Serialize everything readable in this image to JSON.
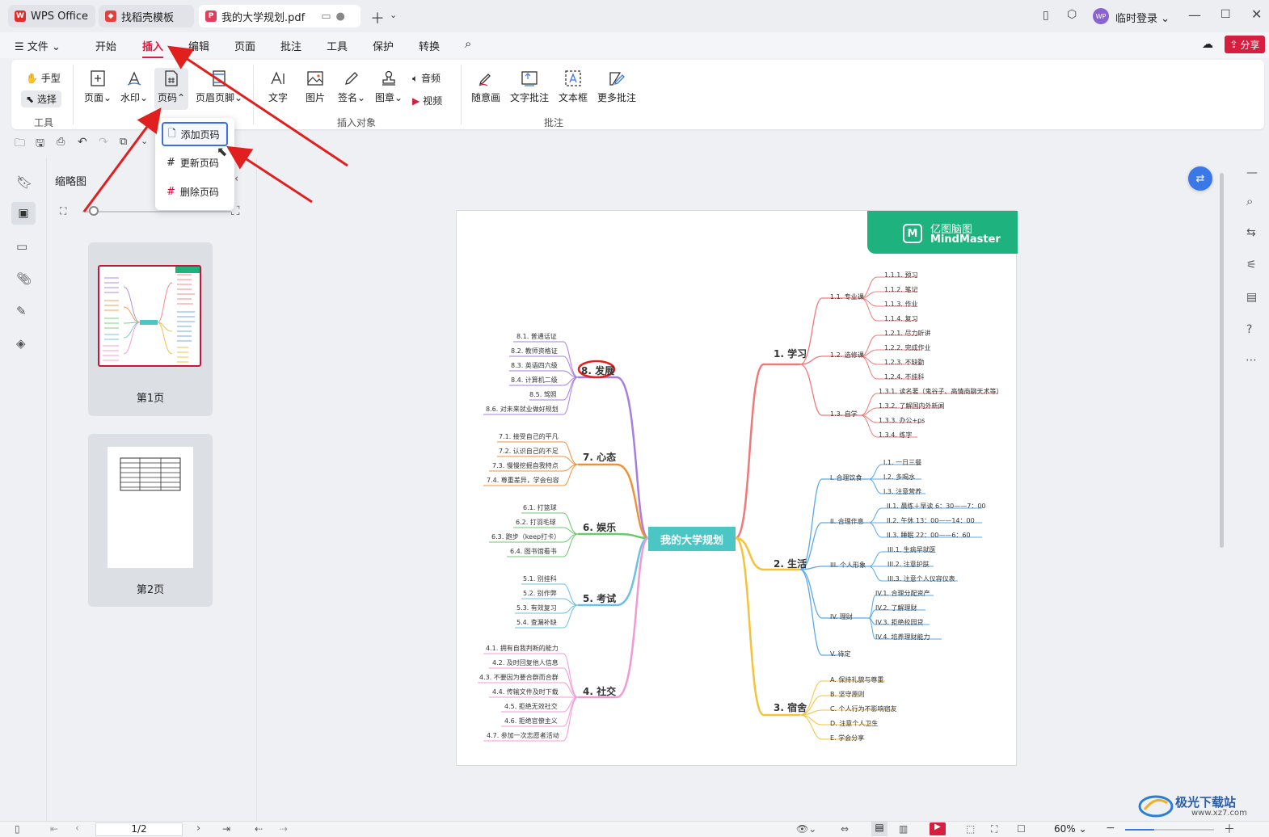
{
  "tabs": [
    {
      "label": "WPS Office"
    },
    {
      "label": "找稻壳模板"
    },
    {
      "label": "我的大学规划.pdf"
    }
  ],
  "account": {
    "label": "临时登录",
    "avatar": "WP"
  },
  "menu": {
    "file": "文件",
    "items": [
      "开始",
      "插入",
      "编辑",
      "页面",
      "批注",
      "工具",
      "保护",
      "转换"
    ],
    "share": "分享"
  },
  "ribbon": {
    "hand": "手型",
    "select": "选择",
    "group_tools": "工具",
    "page": "页面",
    "watermark": "水印",
    "pagenum": "页码",
    "headerfooter": "页眉页脚",
    "text": "文字",
    "image": "图片",
    "sign": "签名",
    "stamp": "图章",
    "audio": "音频",
    "video": "视频",
    "group_insert": "插入对象",
    "freehand": "随意画",
    "textnote": "文字批注",
    "textbox": "文本框",
    "morenote": "更多批注",
    "group_annot": "批注"
  },
  "dropdown": {
    "add": "添加页码",
    "update": "更新页码",
    "delete": "删除页码"
  },
  "thumbs": {
    "title": "缩略图",
    "page1": "第1页",
    "page2": "第2页"
  },
  "status": {
    "page": "1/2",
    "zoom": "60%"
  },
  "mindmap": {
    "brand_cn": "亿图脑图",
    "brand_en": "MindMaster",
    "center": "我的大学规划",
    "r1": "1. 学习",
    "r2": "2. 生活",
    "r3": "3. 宿舍",
    "l8": "8. 发展",
    "l7": "7. 心态",
    "l6": "6. 娱乐",
    "l5": "5. 考试",
    "l4": "4. 社交",
    "r1_sub": [
      "1.1. 专业课",
      "1.2. 选修课",
      "1.3. 自学"
    ],
    "r1_leaf": [
      "1.1.1. 预习",
      "1.1.2. 笔记",
      "1.1.3. 作业",
      "1.1.4. 复习",
      "1.2.1. 尽力听讲",
      "1.2.2. 完成作业",
      "1.2.3. 不缺勤",
      "1.2.4. 不挂科",
      "1.3.1. 读名著（鬼谷子、高情商聊天术等）",
      "1.3.2. 了解国内外新闻",
      "1.3.3. 办公+ps",
      "1.3.4. 练字"
    ],
    "r2_sub": [
      "I. 合理饮食",
      "II. 合理作息",
      "III. 个人形象",
      "IV. 理财",
      "V. 待定"
    ],
    "r2_leaf": [
      "I.1. 一日三餐",
      "I.2. 多喝水",
      "I.3. 注意营养",
      "II.1. 晨练＋早读 6：30——7：00",
      "II.2. 午休 13：00——14：00",
      "II.3. 睡眠 22：00——6：60",
      "III.1. 生病早就医",
      "III.2. 注意护肤",
      "III.3. 注意个人仪容仪表",
      "IV.1. 合理分配资产",
      "IV.2. 了解理财",
      "IV.3. 拒绝校园贷",
      "IV.4. 培养理财能力"
    ],
    "r3_leaf": [
      "A. 保持礼貌与尊重",
      "B. 坚守原则",
      "C. 个人行为不影响宿友",
      "D. 注意个人卫生",
      "E. 学会分享"
    ],
    "l8_leaf": [
      "8.1. 普通话证",
      "8.2. 教师资格证",
      "8.3. 英语四六级",
      "8.4. 计算机二级",
      "8.5. 驾照",
      "8.6. 对未来就业做好规划"
    ],
    "l7_leaf": [
      "7.1. 接受自己的平凡",
      "7.2. 认识自己的不足",
      "7.3. 慢慢挖掘自我特点",
      "7.4. 尊重差异，学会包容"
    ],
    "l6_leaf": [
      "6.1. 打篮球",
      "6.2. 打羽毛球",
      "6.3. 跑步（keep打卡）",
      "6.4. 图书馆看书"
    ],
    "l5_leaf": [
      "5.1. 别挂科",
      "5.2. 别作弊",
      "5.3. 有效复习",
      "5.4. 查漏补缺"
    ],
    "l4_leaf": [
      "4.1. 拥有自我判断的能力",
      "4.2. 及时回复他人信息",
      "4.3. 不要因为要合群而合群",
      "4.4. 传输文件及时下载",
      "4.5. 拒绝无效社交",
      "4.6. 拒绝官僚主义",
      "4.7. 参加一次志愿者活动"
    ]
  },
  "watermark": "极光下载站",
  "watermark_url": "www.xz7.com",
  "colors": {
    "accent": "#d81e3f",
    "brand_green": "#1db27e",
    "center": "#4cc5c5",
    "arrow": "#e0201e"
  }
}
